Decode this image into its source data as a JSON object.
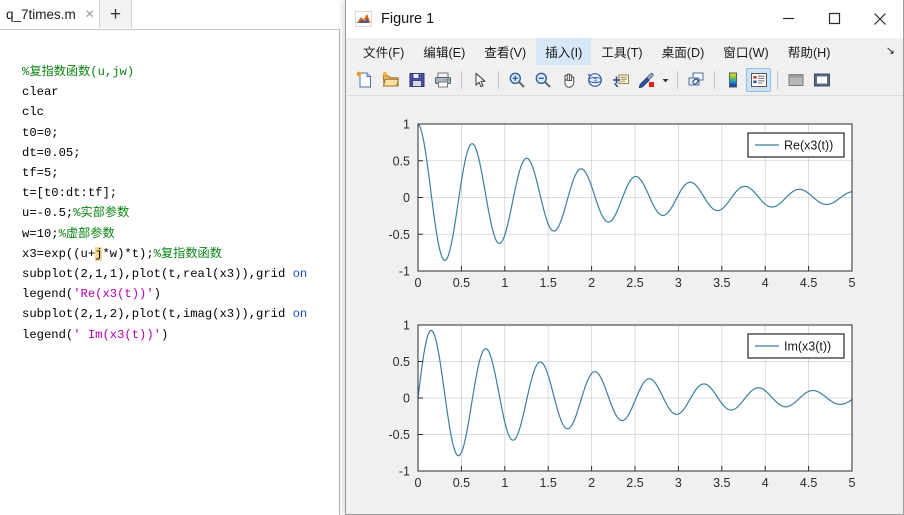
{
  "editor": {
    "tab": {
      "label": "q_7times.m",
      "close_icon": "close-icon"
    },
    "new_tab_label": "+",
    "code_lines": [
      {
        "segments": [
          {
            "t": "%复指数函数(u,jw)",
            "c": "cmt"
          }
        ]
      },
      {
        "segments": [
          {
            "t": "clear",
            "c": ""
          }
        ]
      },
      {
        "segments": [
          {
            "t": "clc",
            "c": ""
          }
        ]
      },
      {
        "segments": [
          {
            "t": "t0=0;",
            "c": ""
          }
        ]
      },
      {
        "segments": [
          {
            "t": "dt=0.05;",
            "c": ""
          }
        ]
      },
      {
        "segments": [
          {
            "t": "tf=5;",
            "c": ""
          }
        ]
      },
      {
        "segments": [
          {
            "t": "t=[t0:dt:tf];",
            "c": ""
          }
        ]
      },
      {
        "segments": [
          {
            "t": "u=-0.5;",
            "c": ""
          },
          {
            "t": "%实部参数",
            "c": "cmt"
          }
        ]
      },
      {
        "segments": [
          {
            "t": "w=10;",
            "c": ""
          },
          {
            "t": "%虚部参数",
            "c": "cmt"
          }
        ]
      },
      {
        "segments": [
          {
            "t": "x3=exp((u+",
            "c": ""
          },
          {
            "t": "j",
            "c": "hl"
          },
          {
            "t": "*w)*t);",
            "c": ""
          },
          {
            "t": "%复指数函数",
            "c": "cmt"
          }
        ]
      },
      {
        "segments": [
          {
            "t": "subplot(2,1,1),plot(t,real(x3)),grid ",
            "c": ""
          },
          {
            "t": "on",
            "c": "kw"
          }
        ]
      },
      {
        "segments": [
          {
            "t": "legend(",
            "c": ""
          },
          {
            "t": "'Re(x3(t))'",
            "c": "str"
          },
          {
            "t": ")",
            "c": ""
          }
        ]
      },
      {
        "segments": [
          {
            "t": "subplot(2,1,2),plot(t,imag(x3)),grid ",
            "c": ""
          },
          {
            "t": "on",
            "c": "kw"
          }
        ]
      },
      {
        "segments": [
          {
            "t": "legend(",
            "c": ""
          },
          {
            "t": "' Im(x3(t))'",
            "c": "str"
          },
          {
            "t": ")",
            "c": ""
          }
        ]
      }
    ]
  },
  "figure": {
    "title": "Figure 1",
    "icon": "matlab-icon",
    "window_buttons": [
      {
        "name": "minimize-button",
        "icon": "minimize-icon"
      },
      {
        "name": "maximize-button",
        "icon": "maximize-icon"
      },
      {
        "name": "close-button",
        "icon": "close-icon"
      }
    ],
    "menus": [
      {
        "label": "文件(F)",
        "name": "menu-file",
        "active": false
      },
      {
        "label": "编辑(E)",
        "name": "menu-edit",
        "active": false
      },
      {
        "label": "查看(V)",
        "name": "menu-view",
        "active": false
      },
      {
        "label": "插入(I)",
        "name": "menu-insert",
        "active": true
      },
      {
        "label": "工具(T)",
        "name": "menu-tools",
        "active": false
      },
      {
        "label": "桌面(D)",
        "name": "menu-desktop",
        "active": false
      },
      {
        "label": "窗口(W)",
        "name": "menu-window",
        "active": false
      },
      {
        "label": "帮助(H)",
        "name": "menu-help",
        "active": false
      }
    ],
    "menu_overflow_icon": "overflow-arrow-icon",
    "toolbar": [
      {
        "name": "new-figure-button",
        "icon": "new-document-icon"
      },
      {
        "name": "open-file-button",
        "icon": "open-folder-icon"
      },
      {
        "name": "save-figure-button",
        "icon": "save-disk-icon"
      },
      {
        "name": "print-figure-button",
        "icon": "printer-icon"
      },
      {
        "name": "separator-1",
        "icon": "separator"
      },
      {
        "name": "edit-plot-button",
        "icon": "pointer-arrow-icon"
      },
      {
        "name": "separator-2",
        "icon": "separator"
      },
      {
        "name": "zoom-in-button",
        "icon": "zoom-in-icon"
      },
      {
        "name": "zoom-out-button",
        "icon": "zoom-out-icon"
      },
      {
        "name": "pan-button",
        "icon": "hand-pan-icon"
      },
      {
        "name": "rotate-3d-button",
        "icon": "rotate-3d-icon"
      },
      {
        "name": "data-cursor-button",
        "icon": "data-cursor-icon"
      },
      {
        "name": "brush-button",
        "icon": "brush-icon"
      },
      {
        "name": "brush-dropdown",
        "icon": "chevron-down-icon"
      },
      {
        "name": "separator-3",
        "icon": "separator"
      },
      {
        "name": "link-plots-button",
        "icon": "link-plots-icon"
      },
      {
        "name": "separator-4",
        "icon": "separator"
      },
      {
        "name": "colorbar-button",
        "icon": "colorbar-icon"
      },
      {
        "name": "legend-button",
        "icon": "legend-icon",
        "active": true
      },
      {
        "name": "separator-5",
        "icon": "separator"
      },
      {
        "name": "hide-plot-tools-button",
        "icon": "hide-plot-tools-icon"
      },
      {
        "name": "show-plot-tools-button",
        "icon": "show-plot-tools-icon"
      }
    ]
  },
  "chart_data": [
    {
      "type": "line",
      "name": "top-subplot",
      "title": "",
      "xlabel": "",
      "ylabel": "",
      "xlim": [
        0,
        5
      ],
      "ylim": [
        -1,
        1
      ],
      "xticks": [
        "0",
        "0.5",
        "1",
        "1.5",
        "2",
        "2.5",
        "3",
        "3.5",
        "4",
        "4.5",
        "5"
      ],
      "yticks": [
        "-1",
        "-0.5",
        "0",
        "0.5",
        "1"
      ],
      "grid": true,
      "legend": {
        "entries": [
          "Re(x3(t))"
        ],
        "position": "top-right"
      },
      "series": [
        {
          "name": "Re(x3(t))",
          "color": "#3b7ea1",
          "formula": "exp(-0.5*t)*cos(10*t)",
          "params": {
            "u": -0.5,
            "w": 10,
            "t0": 0,
            "dt": 0.05,
            "tf": 5
          }
        }
      ]
    },
    {
      "type": "line",
      "name": "bottom-subplot",
      "title": "",
      "xlabel": "",
      "ylabel": "",
      "xlim": [
        0,
        5
      ],
      "ylim": [
        -1,
        1
      ],
      "xticks": [
        "0",
        "0.5",
        "1",
        "1.5",
        "2",
        "2.5",
        "3",
        "3.5",
        "4",
        "4.5",
        "5"
      ],
      "yticks": [
        "-1",
        "-0.5",
        "0",
        "0.5",
        "1"
      ],
      "grid": true,
      "legend": {
        "entries": [
          "Im(x3(t))"
        ],
        "position": "top-right"
      },
      "series": [
        {
          "name": "Im(x3(t))",
          "color": "#3b7ea1",
          "formula": "exp(-0.5*t)*sin(10*t)",
          "params": {
            "u": -0.5,
            "w": 10,
            "t0": 0,
            "dt": 0.05,
            "tf": 5
          }
        }
      ]
    }
  ],
  "colors": {
    "line": "#3b7ea1",
    "figure_bg": "#f0f0f0",
    "axes_bg": "#ffffff",
    "grid": "#d2d2d2",
    "menu_active": "#d6e7f5"
  }
}
